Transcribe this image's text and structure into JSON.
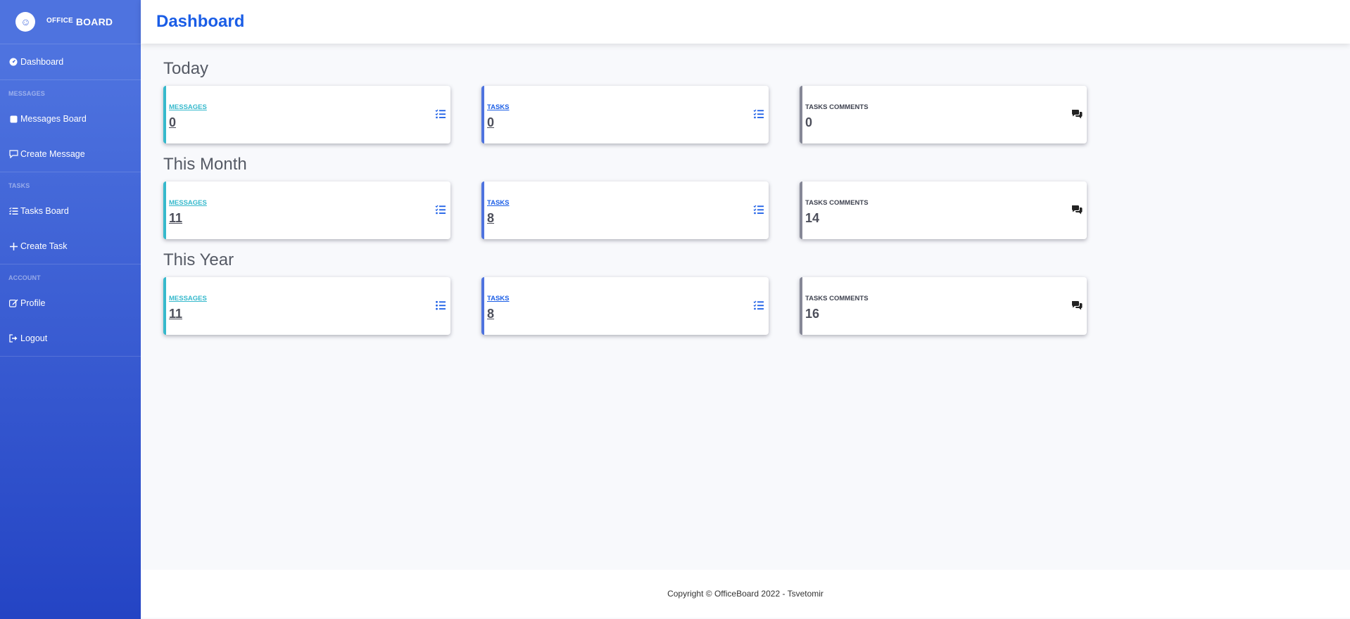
{
  "brand": {
    "small": "OFFICE",
    "big": "BOARD"
  },
  "nav": {
    "dashboard": "Dashboard",
    "messages_heading": "MESSAGES",
    "messages_board": "Messages Board",
    "create_message": "Create Message",
    "tasks_heading": "TASKS",
    "tasks_board": "Tasks Board",
    "create_task": "Create Task",
    "account_heading": "ACCOUNT",
    "profile": "Profile",
    "logout": "Logout"
  },
  "header": {
    "title": "Dashboard"
  },
  "labels": {
    "messages": "MESSAGES",
    "tasks": "TASKS",
    "comments": "TASKS COMMENTS"
  },
  "sections": [
    {
      "title": "Today",
      "messages": "0",
      "tasks": "0",
      "comments": "0"
    },
    {
      "title": "This Month",
      "messages": "11",
      "tasks": "8",
      "comments": "14"
    },
    {
      "title": "This Year",
      "messages": "11",
      "tasks": "8",
      "comments": "16"
    }
  ],
  "footer": {
    "text": "Copyright © OfficeBoard 2022 - Tsvetomir"
  },
  "colors": {
    "accent": "#1a5de6",
    "sidebar_start": "#4e73df",
    "sidebar_end": "#2444c4",
    "messages_border": "#36b9cc",
    "tasks_border": "#4e73df",
    "comments_border": "#858796"
  }
}
